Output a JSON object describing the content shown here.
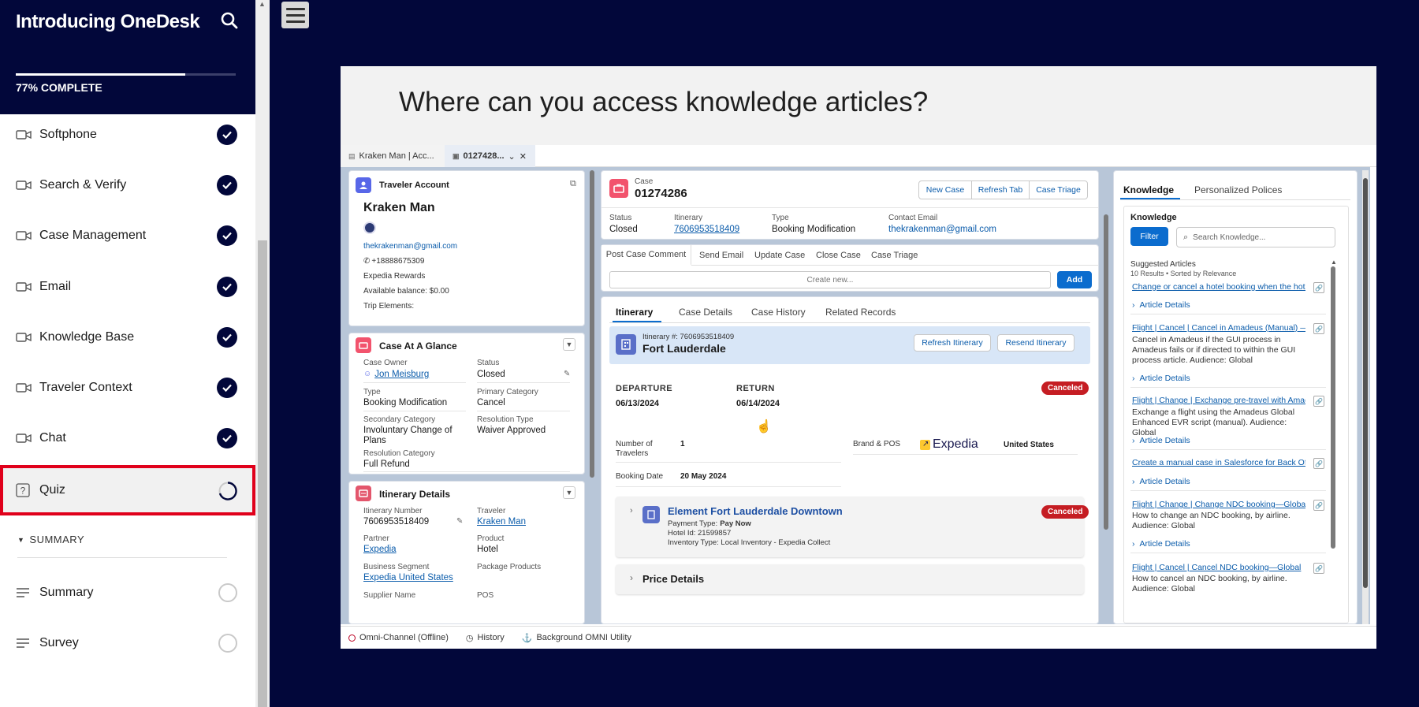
{
  "course": {
    "title": "Introducing OneDesk",
    "progress_text": "77% COMPLETE",
    "progress": 0.77
  },
  "lessons": [
    {
      "label": "Softphone",
      "status": "complete"
    },
    {
      "label": "Search & Verify",
      "status": "complete"
    },
    {
      "label": "Case Management",
      "status": "complete"
    },
    {
      "label": "Email",
      "status": "complete"
    },
    {
      "label": "Knowledge Base",
      "status": "complete"
    },
    {
      "label": "Traveler Context",
      "status": "complete"
    },
    {
      "label": "Chat",
      "status": "complete"
    },
    {
      "label": "Quiz",
      "status": "in-progress"
    }
  ],
  "summary_section": {
    "label": "SUMMARY",
    "items": [
      {
        "label": "Summary"
      },
      {
        "label": "Survey"
      }
    ]
  },
  "question": "Where can you access knowledge articles?",
  "sf": {
    "tabs": [
      "Kraken Man | Acc...",
      "0127428..."
    ],
    "traveler": {
      "header": "Traveler Account",
      "name": "Kraken Man",
      "email": "thekrakenman@gmail.com",
      "phone": "+18888675309",
      "rewards": "Expedia Rewards",
      "balance": "Available balance: $0.00",
      "trip": "Trip Elements:"
    },
    "glance": {
      "header": "Case At A Glance",
      "owner_label": "Case Owner",
      "owner": "Jon Meisburg",
      "status_label": "Status",
      "status": "Closed",
      "type_label": "Type",
      "type": "Booking Modification",
      "primary_label": "Primary Category",
      "primary": "Cancel",
      "secondary_label": "Secondary Category",
      "secondary": "Involuntary Change of Plans",
      "resolution_type_label": "Resolution Type",
      "resolution_type": "Waiver Approved",
      "resolution_cat_label": "Resolution Category",
      "resolution_cat": "Full Refund"
    },
    "itin_details": {
      "header": "Itinerary Details",
      "num_label": "Itinerary Number",
      "num": "7606953518409",
      "traveler_label": "Traveler",
      "traveler": "Kraken Man",
      "partner_label": "Partner",
      "partner": "Expedia",
      "product_label": "Product",
      "product": "Hotel",
      "segment_label": "Business Segment",
      "segment": "Expedia United States",
      "package_label": "Package Products",
      "supplier_label": "Supplier Name",
      "pos_label": "POS"
    },
    "case": {
      "label": "Case",
      "number": "01274286",
      "buttons": [
        "New Case",
        "Refresh Tab",
        "Case Triage"
      ],
      "status_label": "Status",
      "status": "Closed",
      "itinerary_label": "Itinerary",
      "itinerary": "7606953518409",
      "type_label": "Type",
      "type": "Booking Modification",
      "email_label": "Contact Email",
      "email": "thekrakenman@gmail.com",
      "actions": [
        "Post Case Comment",
        "Send Email",
        "Update Case",
        "Close Case",
        "Case Triage"
      ],
      "create_placeholder": "Create new...",
      "add": "Add",
      "subtabs": [
        "Itinerary",
        "Case Details",
        "Case History",
        "Related Records"
      ]
    },
    "itinerary": {
      "number": "Itinerary #: 7606953518409",
      "city": "Fort Lauderdale",
      "refresh": "Refresh Itinerary",
      "resend": "Resend Itinerary",
      "departure_label": "DEPARTURE",
      "departure": "06/13/2024",
      "return_label": "RETURN",
      "return": "06/14/2024",
      "status": "Canceled",
      "travelers_label": "Number of Travelers",
      "travelers": "1",
      "brand_label": "Brand & POS",
      "brand": "Expedia",
      "pos": "United States",
      "booking_label": "Booking Date",
      "booking": "20 May 2024",
      "hotel_name": "Element Fort Lauderdale Downtown",
      "payment_label": "Payment Type:",
      "payment": "Pay Now",
      "hotel_id": "Hotel Id: 21599857",
      "inventory": "Inventory Type: Local Inventory - Expedia Collect",
      "hotel_status": "Canceled",
      "price": "Price Details"
    },
    "knowledge": {
      "tabs": [
        "Knowledge",
        "Personalized Polices"
      ],
      "header": "Knowledge",
      "filter": "Filter",
      "search_placeholder": "Search Knowledge...",
      "suggested": "Suggested Articles",
      "count": "10 Results • Sorted by Relevance",
      "details": "Article Details",
      "articles": [
        {
          "title": "Change or cancel a hotel booking when the hotel i",
          "desc": ""
        },
        {
          "title": "Flight | Cancel | Cancel in Amadeus (Manual) —Glo",
          "desc": "Cancel in Amadeus if the GUI process in Amadeus fails or if directed to within the GUI process article. Audience: Global"
        },
        {
          "title": "Flight | Change | Exchange pre-travel with Amadeu",
          "desc": "Exchange a flight using the Amadeus Global Enhanced EVR script (manual). Audience: Global"
        },
        {
          "title": "Create a manual case in Salesforce for Back Office",
          "desc": ""
        },
        {
          "title": "Flight | Change | Change NDC booking—Global",
          "desc": "How to change an NDC booking, by airline. Audience: Global"
        },
        {
          "title": "Flight | Cancel | Cancel NDC booking—Global",
          "desc": "How to cancel an NDC booking, by airline. Audience: Global"
        }
      ]
    },
    "utility": [
      "Omni-Channel (Offline)",
      "History",
      "Background OMNI Utility"
    ]
  },
  "colors": {
    "navy": "#02073a",
    "brand_blue": "#0b6cce",
    "cancel_red": "#c51d23",
    "highlight": "#e0001b"
  }
}
